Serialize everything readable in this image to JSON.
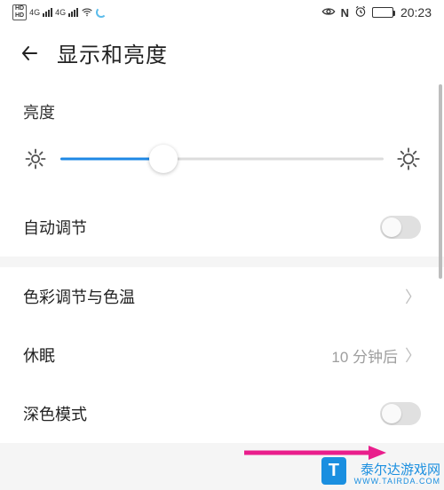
{
  "status": {
    "network_label": "4G",
    "time": "20:23",
    "nfc": "N"
  },
  "header": {
    "title": "显示和亮度"
  },
  "brightness": {
    "label": "亮度",
    "value_percent": 32
  },
  "rows": {
    "auto_adjust": {
      "label": "自动调节",
      "on": false
    },
    "color_temp": {
      "label": "色彩调节与色温"
    },
    "sleep": {
      "label": "休眠",
      "value": "10 分钟后"
    },
    "dark_mode": {
      "label": "深色模式",
      "on": false
    }
  },
  "watermark": {
    "logo": "T",
    "name": "泰尔达游戏网",
    "url": "WWW.TAIRDA.COM"
  }
}
